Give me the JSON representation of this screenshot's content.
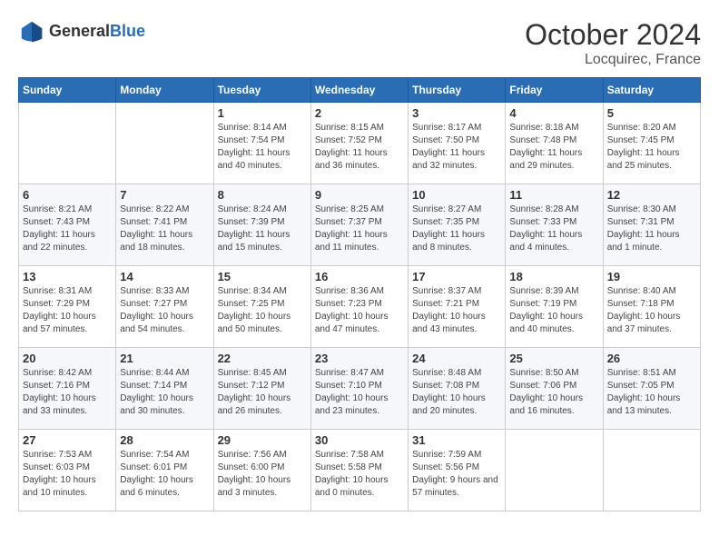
{
  "header": {
    "logo_text_general": "General",
    "logo_text_blue": "Blue",
    "month": "October 2024",
    "location": "Locquirec, France"
  },
  "weekdays": [
    "Sunday",
    "Monday",
    "Tuesday",
    "Wednesday",
    "Thursday",
    "Friday",
    "Saturday"
  ],
  "weeks": [
    [
      {
        "day": "",
        "info": ""
      },
      {
        "day": "",
        "info": ""
      },
      {
        "day": "1",
        "info": "Sunrise: 8:14 AM\nSunset: 7:54 PM\nDaylight: 11 hours and 40 minutes."
      },
      {
        "day": "2",
        "info": "Sunrise: 8:15 AM\nSunset: 7:52 PM\nDaylight: 11 hours and 36 minutes."
      },
      {
        "day": "3",
        "info": "Sunrise: 8:17 AM\nSunset: 7:50 PM\nDaylight: 11 hours and 32 minutes."
      },
      {
        "day": "4",
        "info": "Sunrise: 8:18 AM\nSunset: 7:48 PM\nDaylight: 11 hours and 29 minutes."
      },
      {
        "day": "5",
        "info": "Sunrise: 8:20 AM\nSunset: 7:45 PM\nDaylight: 11 hours and 25 minutes."
      }
    ],
    [
      {
        "day": "6",
        "info": "Sunrise: 8:21 AM\nSunset: 7:43 PM\nDaylight: 11 hours and 22 minutes."
      },
      {
        "day": "7",
        "info": "Sunrise: 8:22 AM\nSunset: 7:41 PM\nDaylight: 11 hours and 18 minutes."
      },
      {
        "day": "8",
        "info": "Sunrise: 8:24 AM\nSunset: 7:39 PM\nDaylight: 11 hours and 15 minutes."
      },
      {
        "day": "9",
        "info": "Sunrise: 8:25 AM\nSunset: 7:37 PM\nDaylight: 11 hours and 11 minutes."
      },
      {
        "day": "10",
        "info": "Sunrise: 8:27 AM\nSunset: 7:35 PM\nDaylight: 11 hours and 8 minutes."
      },
      {
        "day": "11",
        "info": "Sunrise: 8:28 AM\nSunset: 7:33 PM\nDaylight: 11 hours and 4 minutes."
      },
      {
        "day": "12",
        "info": "Sunrise: 8:30 AM\nSunset: 7:31 PM\nDaylight: 11 hours and 1 minute."
      }
    ],
    [
      {
        "day": "13",
        "info": "Sunrise: 8:31 AM\nSunset: 7:29 PM\nDaylight: 10 hours and 57 minutes."
      },
      {
        "day": "14",
        "info": "Sunrise: 8:33 AM\nSunset: 7:27 PM\nDaylight: 10 hours and 54 minutes."
      },
      {
        "day": "15",
        "info": "Sunrise: 8:34 AM\nSunset: 7:25 PM\nDaylight: 10 hours and 50 minutes."
      },
      {
        "day": "16",
        "info": "Sunrise: 8:36 AM\nSunset: 7:23 PM\nDaylight: 10 hours and 47 minutes."
      },
      {
        "day": "17",
        "info": "Sunrise: 8:37 AM\nSunset: 7:21 PM\nDaylight: 10 hours and 43 minutes."
      },
      {
        "day": "18",
        "info": "Sunrise: 8:39 AM\nSunset: 7:19 PM\nDaylight: 10 hours and 40 minutes."
      },
      {
        "day": "19",
        "info": "Sunrise: 8:40 AM\nSunset: 7:18 PM\nDaylight: 10 hours and 37 minutes."
      }
    ],
    [
      {
        "day": "20",
        "info": "Sunrise: 8:42 AM\nSunset: 7:16 PM\nDaylight: 10 hours and 33 minutes."
      },
      {
        "day": "21",
        "info": "Sunrise: 8:44 AM\nSunset: 7:14 PM\nDaylight: 10 hours and 30 minutes."
      },
      {
        "day": "22",
        "info": "Sunrise: 8:45 AM\nSunset: 7:12 PM\nDaylight: 10 hours and 26 minutes."
      },
      {
        "day": "23",
        "info": "Sunrise: 8:47 AM\nSunset: 7:10 PM\nDaylight: 10 hours and 23 minutes."
      },
      {
        "day": "24",
        "info": "Sunrise: 8:48 AM\nSunset: 7:08 PM\nDaylight: 10 hours and 20 minutes."
      },
      {
        "day": "25",
        "info": "Sunrise: 8:50 AM\nSunset: 7:06 PM\nDaylight: 10 hours and 16 minutes."
      },
      {
        "day": "26",
        "info": "Sunrise: 8:51 AM\nSunset: 7:05 PM\nDaylight: 10 hours and 13 minutes."
      }
    ],
    [
      {
        "day": "27",
        "info": "Sunrise: 7:53 AM\nSunset: 6:03 PM\nDaylight: 10 hours and 10 minutes."
      },
      {
        "day": "28",
        "info": "Sunrise: 7:54 AM\nSunset: 6:01 PM\nDaylight: 10 hours and 6 minutes."
      },
      {
        "day": "29",
        "info": "Sunrise: 7:56 AM\nSunset: 6:00 PM\nDaylight: 10 hours and 3 minutes."
      },
      {
        "day": "30",
        "info": "Sunrise: 7:58 AM\nSunset: 5:58 PM\nDaylight: 10 hours and 0 minutes."
      },
      {
        "day": "31",
        "info": "Sunrise: 7:59 AM\nSunset: 5:56 PM\nDaylight: 9 hours and 57 minutes."
      },
      {
        "day": "",
        "info": ""
      },
      {
        "day": "",
        "info": ""
      }
    ]
  ]
}
